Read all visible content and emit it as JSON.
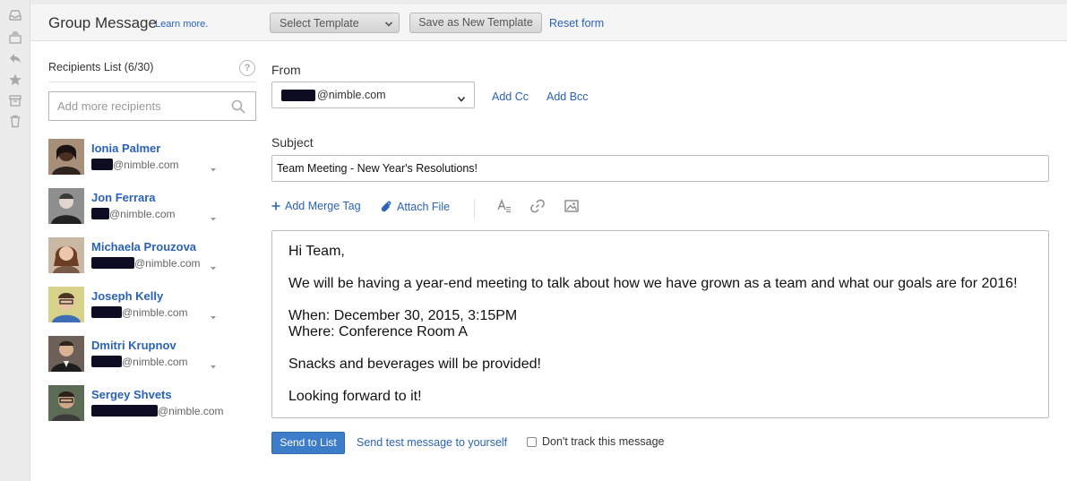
{
  "rail": {
    "icons": [
      "inbox-icon",
      "archive-stack-icon",
      "reply-icon",
      "star-icon",
      "archive-box-icon",
      "trash-icon"
    ]
  },
  "header": {
    "title": "Group Message",
    "learn_more": "Learn more.",
    "template_select": "Select Template",
    "save_template": "Save as New Template",
    "reset": "Reset form"
  },
  "recipients": {
    "title": "Recipients List (6/30)",
    "help": "?",
    "search_placeholder": "Add more recipients",
    "items": [
      {
        "name": "Ionia Palmer",
        "email_domain": "@nimble.com"
      },
      {
        "name": "Jon Ferrara",
        "email_domain": "@nimble.com"
      },
      {
        "name": "Michaela Prouzova",
        "email_domain": "@nimble.com"
      },
      {
        "name": "Joseph Kelly",
        "email_domain": "@nimble.com"
      },
      {
        "name": "Dmitri Krupnov",
        "email_domain": "@nimble.com"
      },
      {
        "name": "Sergey Shvets",
        "email_domain": "@nimble.com"
      }
    ]
  },
  "compose": {
    "from_label": "From",
    "from_value": "@nimble.com",
    "add_cc": "Add Cc",
    "add_bcc": "Add Bcc",
    "subject_label": "Subject",
    "subject_value": "Team Meeting - New Year's Resolutions!",
    "add_merge_tag": "Add Merge Tag",
    "attach_file": "Attach File",
    "body_lines": [
      "Hi Team,",
      "We will be having a year-end meeting to talk about how we have grown as a team and what our goals are for 2016!",
      "When: December 30, 2015, 3:15PM",
      "Where: Conference Room A",
      "Snacks and beverages will be provided!",
      "Looking forward to it!"
    ]
  },
  "footer": {
    "send": "Send to List",
    "send_test": "Send test message to yourself",
    "dont_track": "Don't track this message"
  },
  "colors": {
    "link": "#2a62b7",
    "primary_button": "#3d7cc9"
  }
}
